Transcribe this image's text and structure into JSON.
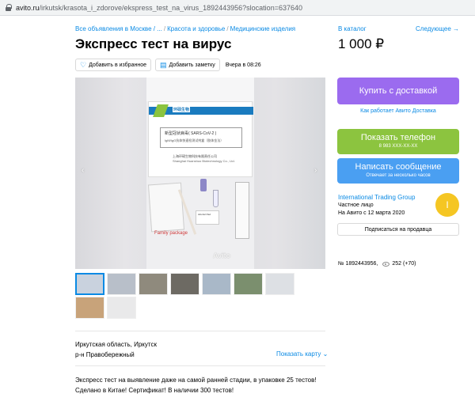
{
  "browser": {
    "url_host": "avito.ru",
    "url_path": "/irkutsk/krasota_i_zdorove/ekspress_test_na_virus_1892443956?slocation=637640"
  },
  "breadcrumbs": [
    "Все объявления в Москве / ...",
    "Красота и здоровье",
    "Медицинские изделия"
  ],
  "nav": {
    "catalog": "В каталог",
    "next": "Следующее →"
  },
  "listing": {
    "title": "Экспресс тест на вирус",
    "price": "1 000 ₽",
    "favorite_label": "Добавить в избранное",
    "note_label": "Добавить заметку",
    "date": "Вчера в 08:26"
  },
  "photo": {
    "box_brand": "环硕生物",
    "box_line1": "新型冠状病毒( SARS-CoV-2 )",
    "box_line2": "IgM/IgG抗体快速检测试剂盒（胶体金法）",
    "box_line3": "上海环硕生物科技有限责任公司",
    "box_line4": "Shanghai Huanshuo Biotechnology Co., Ltd.",
    "pad_label": "Alcohol Pad",
    "family": "Family package",
    "watermark": "Avito"
  },
  "thumbnails": [
    {
      "color": "#c9d2de"
    },
    {
      "color": "#b8bfc9"
    },
    {
      "color": "#8f8a7d"
    },
    {
      "color": "#6d6a63"
    },
    {
      "color": "#a9b8c8"
    },
    {
      "color": "#7b8f6e"
    },
    {
      "color": "#dde0e4"
    },
    {
      "color": "#c8a37a"
    },
    {
      "color": "#e9e9ea"
    }
  ],
  "location": {
    "region": "Иркутская область, Иркутск",
    "district": "р-н Правобережный",
    "map_link": "Показать карту"
  },
  "description": "Экспресс тест на выявление даже на самой ранней стадии, в упаковке 25 тестов! Сделано в Китае! Сертификат! В наличии 300 тестов!",
  "sidebar": {
    "buy_label": "Купить с доставкой",
    "buy_info": "Как работает Авито Доставка",
    "phone_label": "Показать телефон",
    "phone_number": "8 983 XXX-XX-XX",
    "message_label": "Написать сообщение",
    "message_sub": "Отвечает за несколько часов",
    "seller_name": "International Trading Group",
    "seller_type": "Частное лицо",
    "seller_since": "На Авито с 12 марта 2020",
    "avatar_letter": "I",
    "subscribe_label": "Подписаться на продавца",
    "item_id": "№ 1892443956,",
    "views": "252 (+70)"
  },
  "colors": {
    "link": "#0a8ae4",
    "buy": "#9b6bef",
    "phone": "#8cc43f",
    "message": "#4a9ff2",
    "avatar": "#f5c623"
  }
}
